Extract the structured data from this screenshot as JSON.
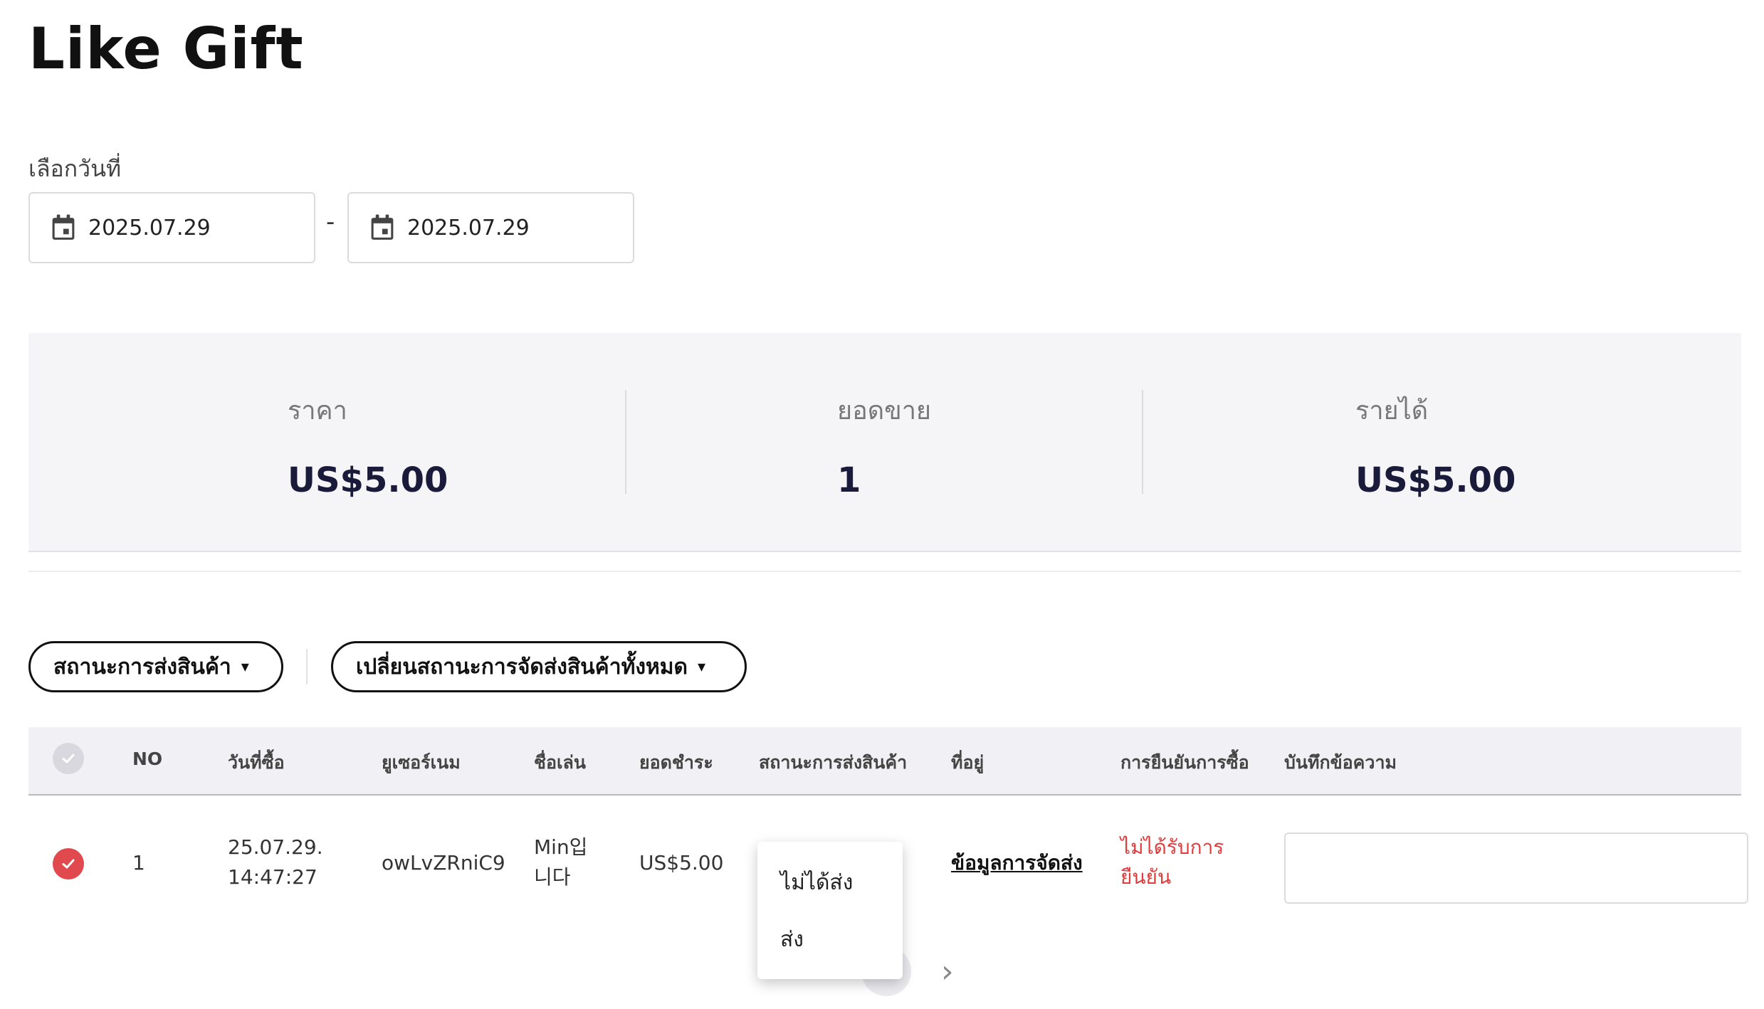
{
  "page": {
    "title": "Like Gift"
  },
  "date_filter": {
    "label": "เลือกวันที่",
    "start": "2025.07.29",
    "separator": "-",
    "end": "2025.07.29"
  },
  "summary": {
    "price": {
      "label": "ราคา",
      "value": "US$5.00"
    },
    "sales": {
      "label": "ยอดขาย",
      "value": "1"
    },
    "revenue": {
      "label": "รายได้",
      "value": "US$5.00"
    }
  },
  "filters": {
    "delivery_status": "สถานะการส่งสินค้า",
    "change_all_status": "เปลี่ยนสถานะการจัดส่งสินค้าทั้งหมด",
    "caret": "▾"
  },
  "table": {
    "headers": {
      "no": "NO",
      "date": "วันที่ซื้อ",
      "username": "ยูเซอร์เนม",
      "nickname": "ชื่อเล่น",
      "amount": "ยอดชำระ",
      "delivery_status": "สถานะการส่งสินค้า",
      "address": "ที่อยู่",
      "purchase_confirm": "การยืนยันการซื้อ",
      "memo": "บันทึกข้อความ"
    },
    "rows": [
      {
        "no": "1",
        "date_line1": "25.07.29.",
        "date_line2": "14:47:27",
        "username": "owLvZRniC9",
        "nickname_line1": "Min입",
        "nickname_line2": "니다",
        "amount": "US$5.00",
        "address_link": "ข้อมูลการจัดส่ง",
        "confirm_line1": "ไม่ได้รับการ",
        "confirm_line2": "ยืนยัน",
        "memo": ""
      }
    ]
  },
  "status_dropdown": {
    "options": [
      "ไม่ได้ส่ง",
      "ส่ง"
    ]
  },
  "pager": {
    "next": "›"
  },
  "colors": {
    "accent_red": "#e04a4f",
    "unconfirmed_text": "#e23b3b",
    "summary_bg": "#f5f5f8",
    "header_bg": "#f1f1f5"
  }
}
